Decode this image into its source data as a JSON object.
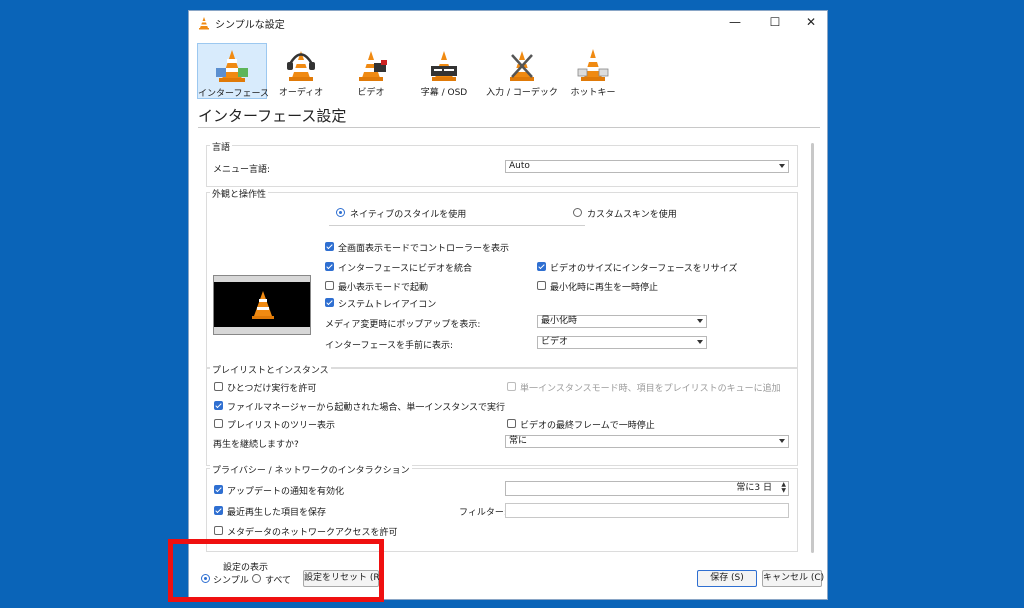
{
  "window": {
    "title": "シンプルな設定",
    "controls": {
      "minimize": "—",
      "maximize": "☐",
      "close": "✕"
    }
  },
  "toolbar": {
    "categories": [
      {
        "label": "インターフェース",
        "icon": "interface-cone-icon",
        "active": true
      },
      {
        "label": "オーディオ",
        "icon": "audio-headphones-cone-icon",
        "active": false
      },
      {
        "label": "ビデオ",
        "icon": "video-cone-icon",
        "active": false
      },
      {
        "label": "字幕 / OSD",
        "icon": "subtitle-cone-icon",
        "active": false
      },
      {
        "label": "入力 / コーデック",
        "icon": "input-codec-cone-icon",
        "active": false
      },
      {
        "label": "ホットキー",
        "icon": "hotkey-cone-icon",
        "active": false
      }
    ]
  },
  "heading": "インターフェース設定",
  "language": {
    "group_title": "言語",
    "menu_label": "メニュー言語:",
    "menu_value": "Auto"
  },
  "appearance": {
    "group_title": "外観と操作性",
    "radio_native": "ネイティブのスタイルを使用",
    "radio_custom": "カスタムスキンを使用",
    "native_selected": true,
    "cb_fullscreen_controller": "全画面表示モードでコントローラーを表示",
    "cb_integrate_video": "インターフェースにビデオを統合",
    "cb_resize_interface": "ビデオのサイズにインターフェースをリサイズ",
    "cb_minimal_mode": "最小表示モードで起動",
    "cb_pause_minimized": "最小化時に再生を一時停止",
    "cb_systray": "システムトレイアイコン",
    "popup_label": "メディア変更時にポップアップを表示:",
    "popup_value": "最小化時",
    "raise_label": "インターフェースを手前に表示:",
    "raise_value": "ビデオ"
  },
  "playlist": {
    "group_title": "プレイリストとインスタンス",
    "cb_one_instance": "ひとつだけ実行を許可",
    "cb_enqueue": "単一インスタンスモード時、項目をプレイリストのキューに追加",
    "cb_file_manager": "ファイルマネージャーから起動された場合、単一インスタンスで実行",
    "cb_tree": "プレイリストのツリー表示",
    "cb_pause_last_frame": "ビデオの最終フレームで一時停止",
    "continue_label": "再生を継続しますか?",
    "continue_value": "常に"
  },
  "privacy": {
    "group_title": "プライバシー / ネットワークのインタラクション",
    "cb_updates": "アップデートの通知を有効化",
    "update_interval": "常に3 日",
    "cb_recent": "最近再生した項目を保存",
    "filter_label": "フィルター:",
    "filter_value": "",
    "cb_metadata": "メタデータのネットワークアクセスを許可"
  },
  "footer": {
    "show_settings_label": "設定の表示",
    "radio_simple": "シンプル",
    "radio_all": "すべて",
    "reset_button": "設定をリセット (R)",
    "save_button": "保存 (S)",
    "cancel_button": "キャンセル (C)"
  },
  "colors": {
    "desktop": "#0a64b8",
    "accent": "#2f6fd1",
    "highlight": "#ef1010",
    "cone_orange": "#f08a12"
  }
}
